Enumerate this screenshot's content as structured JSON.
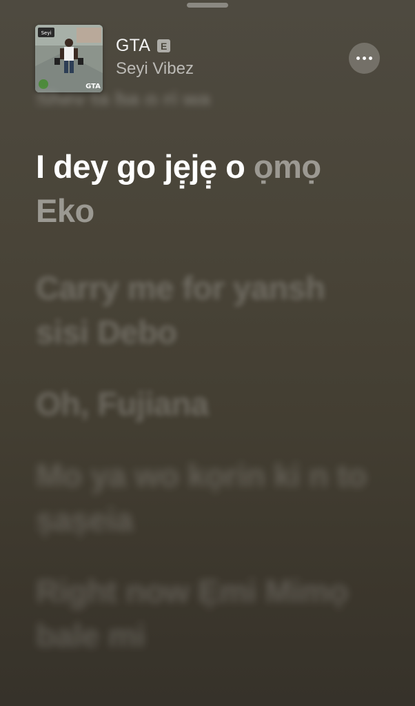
{
  "song": {
    "title": "GTA",
    "explicit_badge": "E",
    "artist": "Seyi Vibez",
    "artwork_caption": "GTA"
  },
  "previous_line": "Shey ta ba o ri wa",
  "active_line": {
    "sung": "I dey go jẹ̣jẹ̣ o ",
    "unsung": "ọmọ Eko"
  },
  "upcoming_lines": [
    "Carry me for yansh sisi Debo",
    "Oh, Fujiana",
    "Mo ya wo kọrin ki n to ṣaṣeia",
    "Right now Ẹmi Mimọ bale mi"
  ]
}
